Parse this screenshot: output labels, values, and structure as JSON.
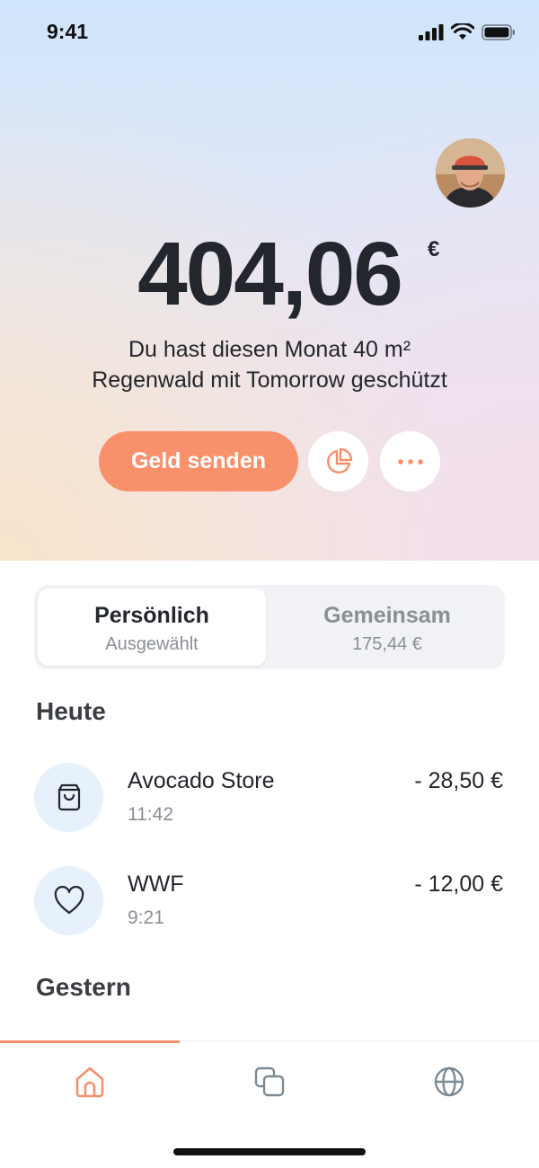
{
  "status_bar": {
    "time": "9:41"
  },
  "profile": {
    "avatar_icon": "user-avatar"
  },
  "balance": {
    "amount": "404,06",
    "currency": "€"
  },
  "impact": {
    "line1": "Du hast diesen Monat 40 m²",
    "line2": "Regenwald mit Tomorrow geschützt"
  },
  "actions": {
    "send_label": "Geld senden",
    "stats_icon": "pie-chart-icon",
    "more_icon": "more-icon"
  },
  "accounts": {
    "tabs": [
      {
        "title": "Persönlich",
        "subtitle": "Ausgewählt"
      },
      {
        "title": "Gemeinsam",
        "subtitle": "175,44 €"
      }
    ]
  },
  "sections": [
    {
      "title": "Heute",
      "transactions": [
        {
          "name": "Avocado Store",
          "time": "11:42",
          "amount": "- 28,50 €",
          "icon": "shopping-bag-icon"
        },
        {
          "name": "WWF",
          "time": "9:21",
          "amount": "- 12,00 €",
          "icon": "heart-icon"
        }
      ]
    },
    {
      "title": "Gestern",
      "transactions": []
    }
  ],
  "tab_bar": {
    "items": [
      {
        "icon": "home-icon",
        "active": true
      },
      {
        "icon": "cards-icon",
        "active": false
      },
      {
        "icon": "globe-icon",
        "active": false
      }
    ]
  },
  "colors": {
    "accent": "#f9906c",
    "text": "#23262d",
    "muted": "#8a8e96",
    "icon_bg": "#e7f1fb"
  }
}
